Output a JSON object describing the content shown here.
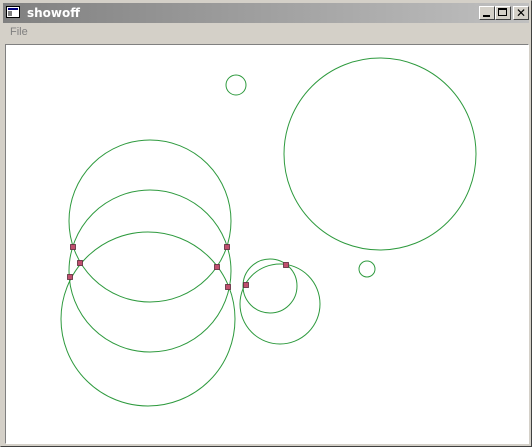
{
  "window": {
    "title": "showoff"
  },
  "menu": {
    "file_label": "File"
  },
  "colors": {
    "circle_stroke": "#2e9a3e",
    "point_fill": "#c0506e",
    "canvas_bg": "#ffffff"
  },
  "icons": {
    "app": "app-window-icon",
    "minimize": "minimize-icon",
    "maximize": "maximize-icon",
    "close": "close-icon"
  }
}
